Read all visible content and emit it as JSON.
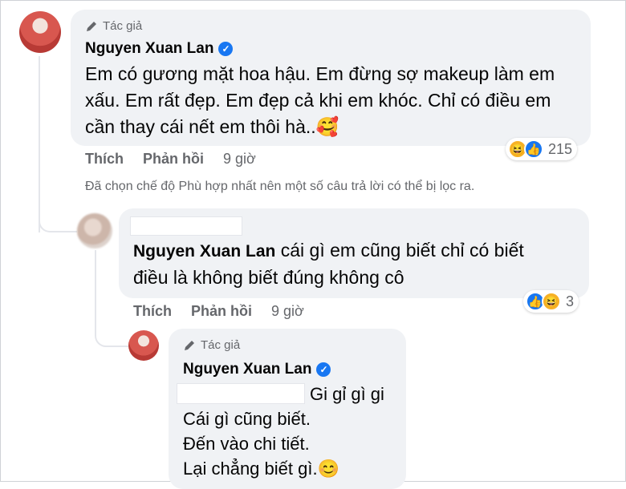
{
  "colors": {
    "bubble": "#f0f2f5",
    "meta": "#65676b",
    "verified": "#1877f2"
  },
  "comment1": {
    "author_badge": "Tác giả",
    "name": "Nguyen Xuan Lan",
    "lines": [
      "Em có gương mặt hoa hậu. Em đừng sợ makeup làm em",
      "xấu. Em rất đẹp. Em đẹp cả khi em khóc. Chỉ có điều em",
      "cần thay cái nết em thôi hà..🥰"
    ],
    "like_label": "Thích",
    "reply_label": "Phản hồi",
    "time": "9 giờ",
    "reaction_count": "215",
    "reaction_icons": [
      "haha-icon",
      "like-icon"
    ],
    "filter_note": "Đã chọn chế độ Phù hợp nhất nên một số câu trả lời có thể bị lọc ra."
  },
  "comment2": {
    "mention": "Nguyen Xuan Lan",
    "lines": [
      "cái gì em cũng biết chỉ có biết",
      "điều là không biết đúng không cô"
    ],
    "like_label": "Thích",
    "reply_label": "Phản hồi",
    "time": "9 giờ",
    "reaction_count": "3",
    "reaction_icons": [
      "like-icon",
      "haha-icon"
    ]
  },
  "comment3": {
    "author_badge": "Tác giả",
    "name": "Nguyen Xuan Lan",
    "lines": [
      "Gi gỉ gì gi",
      "Cái gì cũng biết.",
      "Đến vào chi tiết.",
      "Lại chẳng biết gì.😊"
    ]
  }
}
